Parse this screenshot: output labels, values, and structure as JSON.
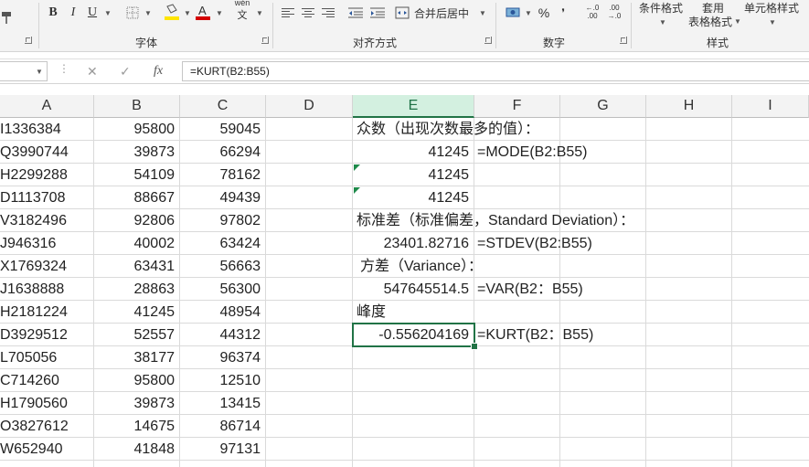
{
  "ribbon": {
    "font_buttons": {
      "bold": "B",
      "italic": "I",
      "underline": "U"
    },
    "phonetic": "wén",
    "merge_center": "合并后居中",
    "percent": "%",
    "comma": "❜",
    "decimal_increase": ".0\n.00",
    "decimal_decrease": ".00\n.0",
    "conditional_format": "条件格式",
    "table_format_1": "套用",
    "table_format_2": "表格格式",
    "cell_styles": "单元格样式",
    "groups": {
      "font": "字体",
      "alignment": "对齐方式",
      "number": "数字",
      "styles": "样式"
    },
    "colors": {
      "fill": "#ffe500",
      "font": "#d40000"
    }
  },
  "formula_bar": {
    "fx": "fx",
    "formula": "=KURT(B2:B55)"
  },
  "columns": [
    "A",
    "B",
    "C",
    "D",
    "E",
    "F",
    "G",
    "H",
    "I"
  ],
  "selected_column": "E",
  "rows": [
    {
      "a": "I1336384",
      "b": "95800",
      "c": "59045"
    },
    {
      "a": "Q3990744",
      "b": "39873",
      "c": "66294"
    },
    {
      "a": "H2299288",
      "b": "54109",
      "c": "78162"
    },
    {
      "a": "D1113708",
      "b": "88667",
      "c": "49439"
    },
    {
      "a": "V3182496",
      "b": "92806",
      "c": "97802"
    },
    {
      "a": "J946316",
      "b": "40002",
      "c": "63424"
    },
    {
      "a": "X1769324",
      "b": "63431",
      "c": "56663"
    },
    {
      "a": "J1638888",
      "b": "28863",
      "c": "56300"
    },
    {
      "a": "H2181224",
      "b": "41245",
      "c": "48954"
    },
    {
      "a": "D3929512",
      "b": "52557",
      "c": "44312"
    },
    {
      "a": "L705056",
      "b": "38177",
      "c": "96374"
    },
    {
      "a": "C714260",
      "b": "95800",
      "c": "12510"
    },
    {
      "a": "H1790560",
      "b": "39873",
      "c": "13415"
    },
    {
      "a": "O3827612",
      "b": "14675",
      "c": "86714"
    },
    {
      "a": "W652940",
      "b": "41848",
      "c": "97131"
    }
  ],
  "stats": {
    "mode_label": "众数（出现次数最多的值）：",
    "mode_value_1": "41245",
    "mode_formula": "=MODE(B2:B55)",
    "mode_value_2": "41245",
    "mode_value_3": "41245",
    "stdev_label": "标准差（标准偏差，Standard Deviation）：",
    "stdev_value": "23401.82716",
    "stdev_formula": "=STDEV(B2:B55)",
    "var_label": "方差（Variance）：",
    "var_value": "547645514.5",
    "var_formula": "=VAR(B2：B55)",
    "kurt_label": "峰度",
    "kurt_value": "-0.556204169",
    "kurt_formula": "=KURT(B2：B55)"
  }
}
